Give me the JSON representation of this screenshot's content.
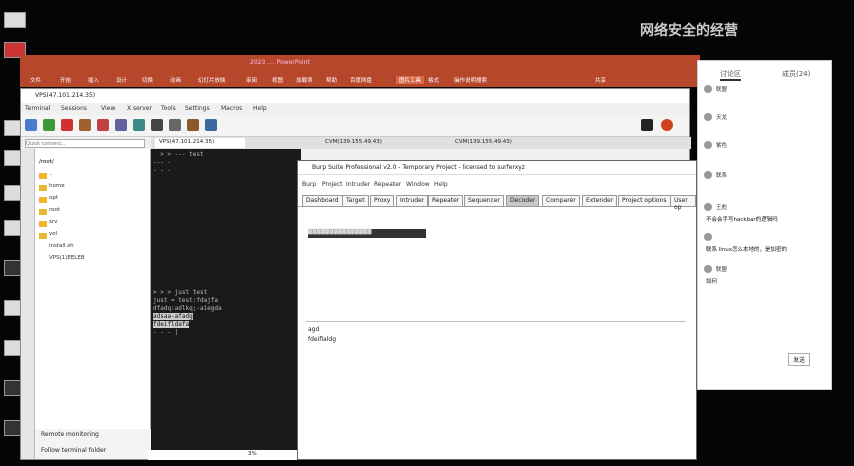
{
  "watermark": "网络安全的经营",
  "ppt": {
    "title": "2023 .... PowerPoint",
    "menu": [
      "文件",
      "开始",
      "插入",
      "设计",
      "切换",
      "动画",
      "幻灯片放映",
      "审阅",
      "视图",
      "加载项",
      "帮助",
      "百度网盘",
      "图片工具",
      "格式",
      "操作说明搜索"
    ],
    "share": "共享"
  },
  "moba": {
    "title": "VPS(47.101.214.35)",
    "menu": [
      "Terminal",
      "Sessions",
      "View",
      "X server",
      "Tools",
      "Settings",
      "Macros",
      "Help"
    ],
    "quick_connect_placeholder": "Quick connect...",
    "tabs": [
      "VPS(47.101.214.35)",
      "CVM(139.155.49.43)",
      "CVM(139.155.49.43)"
    ],
    "file_path": "/root/",
    "files": [
      ".. ",
      "home",
      "opt",
      "root",
      "srv",
      "vol",
      "install.sh",
      "VPS(1)EELEB"
    ],
    "terminal_lines": [
      "  > > --- test",
      "--- -",
      "- - -",
      "",
      "",
      "",
      "",
      "",
      "",
      "",
      "",
      "",
      "",
      "",
      "",
      "",
      "",
      "> > > just test",
      "just = test:fdajfa",
      "dfadq:adlkq;-aiegda",
      "adsaa-afadg",
      "fdeifldafa",
      "- - - |"
    ],
    "remote_monitoring": "Remote monitoring",
    "follow_terminal": "Follow terminal folder",
    "status": "3%"
  },
  "burp": {
    "title": "Burp Suite Professional v2.0 - Temporary Project - licensed to surferxyz",
    "menu": [
      "Burp",
      "Project",
      "Intruder",
      "Repeater",
      "Window",
      "Help"
    ],
    "tabs": [
      "Dashboard",
      "Target",
      "Proxy",
      "Intruder",
      "Repeater",
      "Sequencer",
      "Decoder",
      "Comparer",
      "Extender",
      "Project options",
      "User op"
    ],
    "active_tab": "Decoder",
    "decoded_text": "▓▓▓▓▓▓▓▓▓▓▓▓▓▓▓",
    "text_top": "agd",
    "text_bottom": "fdeiflaldg"
  },
  "chat": {
    "tab_discuss": "讨论区",
    "tab_members": "成员(24)",
    "users": [
      "联盟",
      "天龙",
      "紫色",
      "联系",
      "王彪",
      "不会会手",
      "联盟"
    ],
    "message_1": "不会会手写hackbar的逻辑吗",
    "message_2": "联系 linux怎么本地的，是加密的",
    "message_3": "如何",
    "send_button": "发送"
  },
  "colors": {
    "ppt_red": "#b7472a",
    "terminal_bg": "#1a1a1a"
  }
}
